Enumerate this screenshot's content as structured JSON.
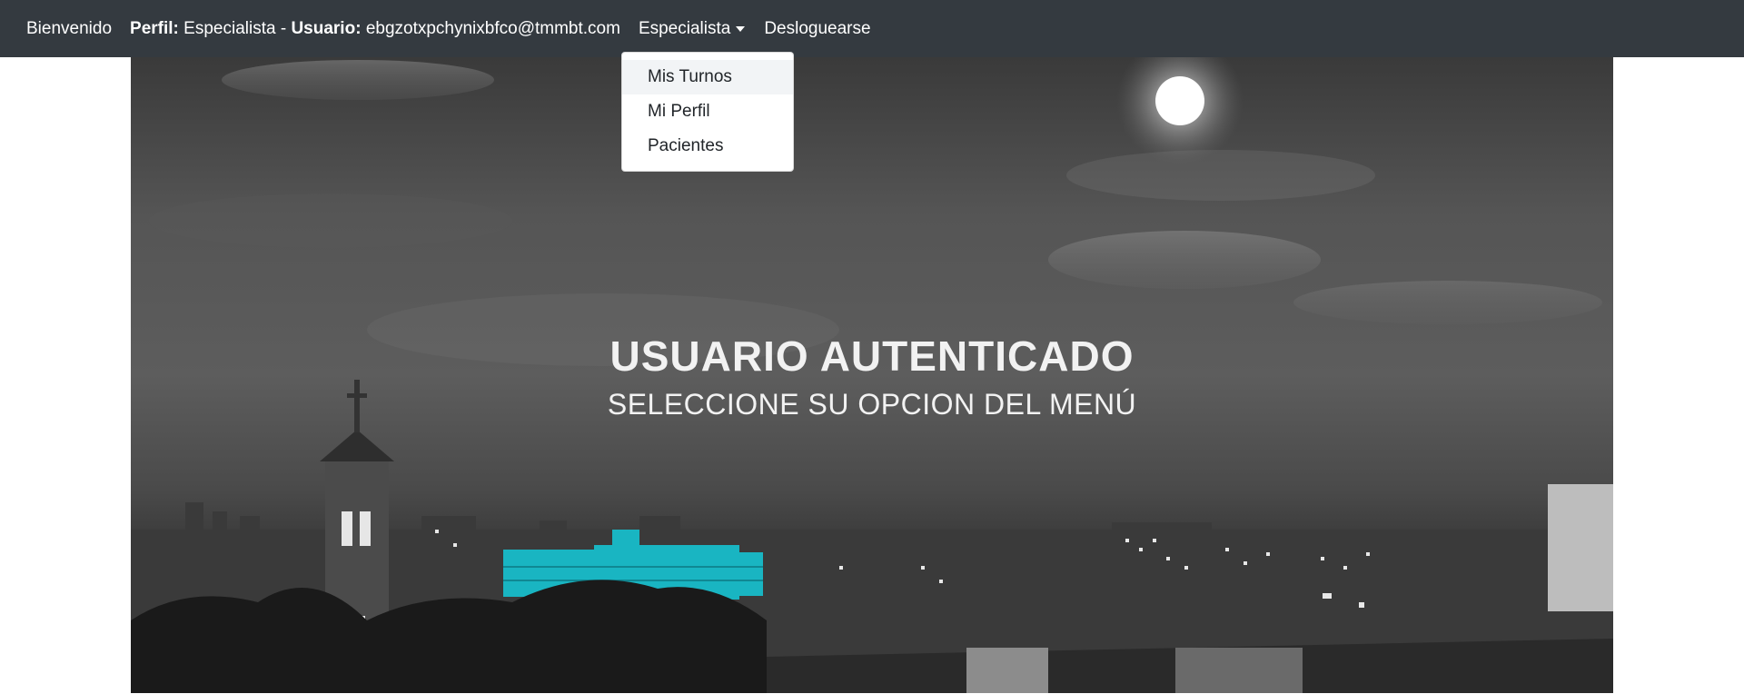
{
  "navbar": {
    "brand": "Bienvenido",
    "profile_label": "Perfil:",
    "profile_value": "Especialista",
    "separator": "-",
    "user_label": "Usuario:",
    "user_value": "ebgzotxpchynixbfco@tmmbt.com",
    "dropdown_label": "Especialista",
    "logout": "Desloguearse"
  },
  "dropdown": {
    "items": [
      {
        "label": "Mis Turnos"
      },
      {
        "label": "Mi Perfil"
      },
      {
        "label": "Pacientes"
      }
    ]
  },
  "hero": {
    "title": "USUARIO AUTENTICADO",
    "subtitle": "SELECCIONE SU OPCION DEL MENÚ"
  },
  "colors": {
    "navbar_bg": "#343a40",
    "accent_building": "#19b5c2"
  }
}
